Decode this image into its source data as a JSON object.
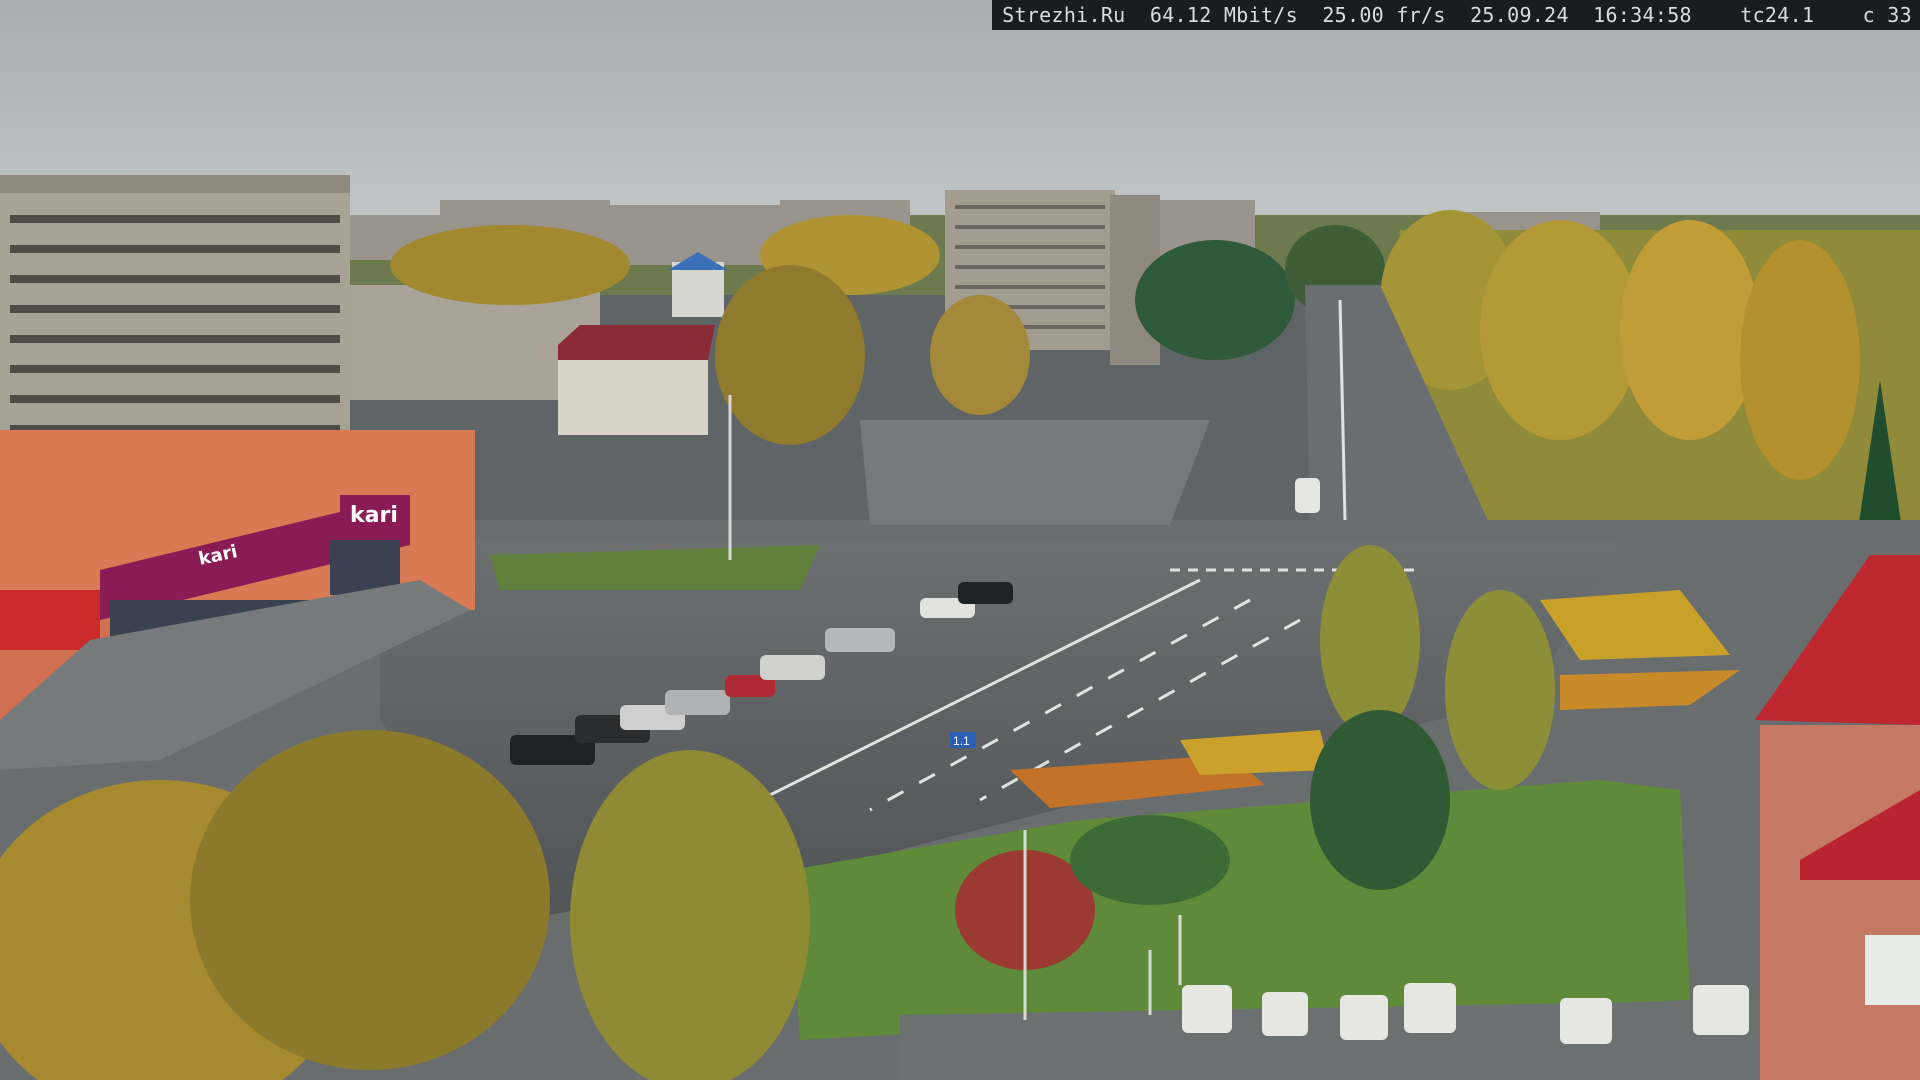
{
  "overlay": {
    "site": "Strezhi.Ru",
    "bitrate": "64.12 Mbit/s",
    "framerate": "25.00 fr/s",
    "date": "25.09.24",
    "time": "16:34:58",
    "camera": "tc24.1",
    "counter": "c 33"
  },
  "signs": {
    "store_main": "kari",
    "store_facade": "kari",
    "road_sign": "1.1"
  },
  "colors": {
    "sky": "#b8bdbf",
    "asphalt": "#5c5f61",
    "grass": "#5f8a3a",
    "store_brand": "#8a1c55",
    "roof_red": "#c0282f"
  }
}
